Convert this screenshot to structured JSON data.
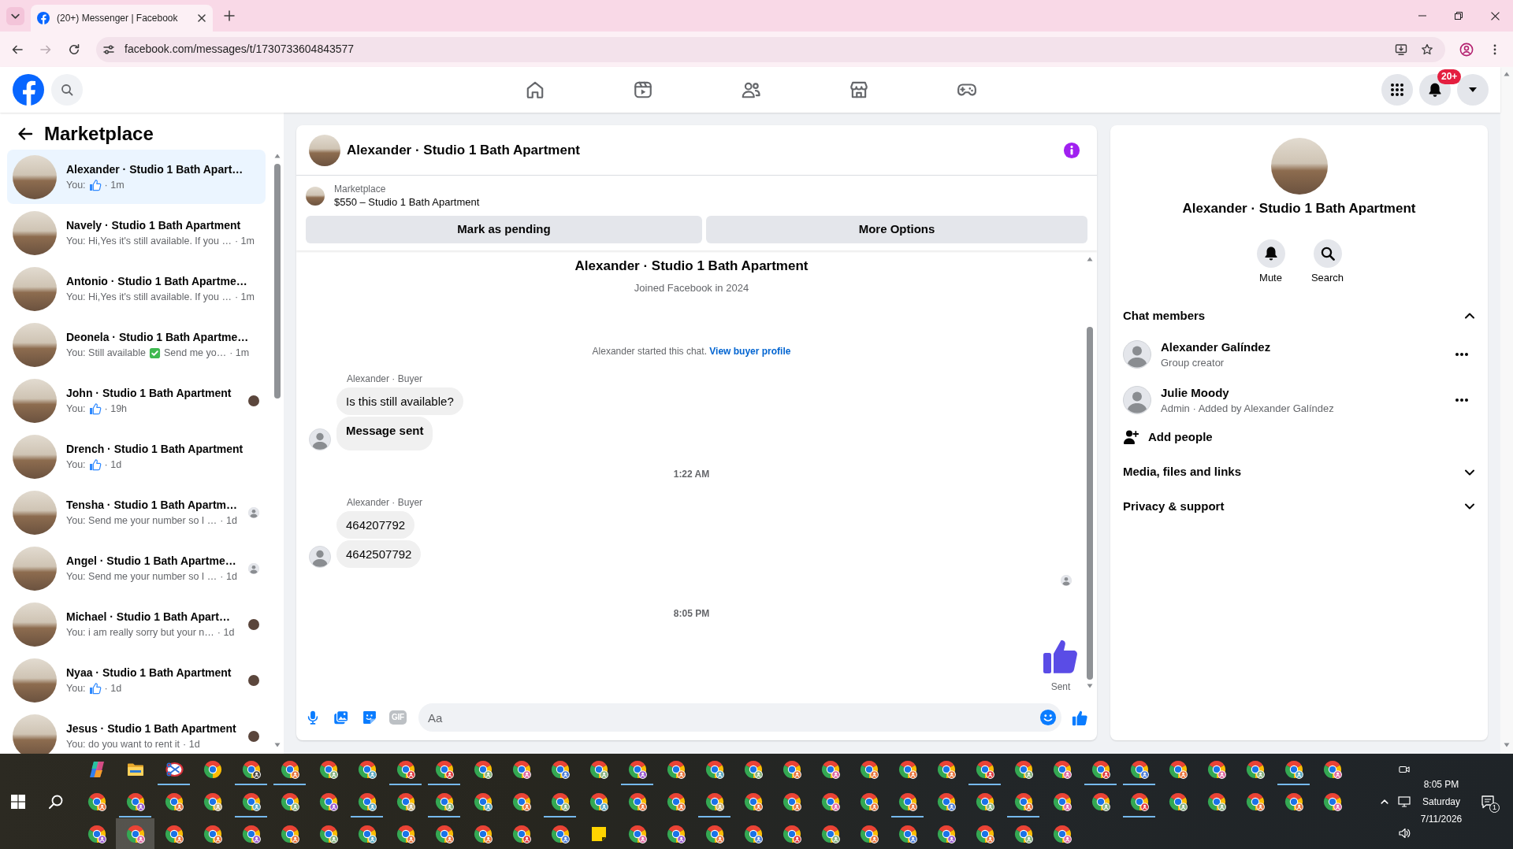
{
  "browser": {
    "tabs": [
      {
        "title": "(20+) Messenger | Facebook",
        "selected": true
      }
    ],
    "url": "facebook.com/messages/t/1730733604843577"
  },
  "header": {
    "nav": [
      {
        "kind": "home",
        "selected": false
      },
      {
        "kind": "video",
        "selected": false
      },
      {
        "kind": "friends",
        "selected": false
      },
      {
        "kind": "marketplace",
        "selected": false
      },
      {
        "kind": "gaming",
        "selected": false
      }
    ],
    "notification_badge": "20+"
  },
  "sidebar": {
    "title": "Marketplace",
    "conversations": [
      {
        "name": "Alexander · Studio 1 Bath Apart…",
        "preview": [
          {
            "kind": "text",
            "text": "You:"
          },
          {
            "kind": "like"
          }
        ],
        "time": "· 1m",
        "selected": true
      },
      {
        "name": "Navely · Studio 1 Bath Apartment",
        "preview": [
          {
            "kind": "text",
            "text": "You: Hi,Yes it's still available. If you …"
          }
        ],
        "time": "· 1m",
        "selected": false
      },
      {
        "name": "Antonio · Studio 1 Bath Apartme…",
        "preview": [
          {
            "kind": "text",
            "text": "You: Hi,Yes it's still available. If you …"
          }
        ],
        "time": "· 1m",
        "selected": false
      },
      {
        "name": "Deonela · Studio 1 Bath Apartme…",
        "preview": [
          {
            "kind": "text",
            "text": "You: Still available"
          },
          {
            "kind": "check"
          },
          {
            "kind": "text",
            "text": "Send me yo…"
          }
        ],
        "time": "· 1m",
        "selected": false
      },
      {
        "name": "John · Studio 1 Bath Apartment",
        "preview": [
          {
            "kind": "text",
            "text": "You:"
          },
          {
            "kind": "like"
          }
        ],
        "time": "· 19h",
        "selected": false,
        "seen": {
          "kind": "photo"
        }
      },
      {
        "name": "Drench · Studio 1 Bath Apartment",
        "preview": [
          {
            "kind": "text",
            "text": "You:"
          },
          {
            "kind": "like"
          }
        ],
        "time": "· 1d",
        "selected": false
      },
      {
        "name": "Tensha · Studio 1 Bath Apartm…",
        "preview": [
          {
            "kind": "text",
            "text": "You: Send me your number so I …"
          }
        ],
        "time": "· 1d",
        "selected": false,
        "seen": {
          "kind": "placeholder"
        }
      },
      {
        "name": "Angel · Studio 1 Bath Apartme…",
        "preview": [
          {
            "kind": "text",
            "text": "You: Send me your number so I …"
          }
        ],
        "time": "· 1d",
        "selected": false,
        "seen": {
          "kind": "placeholder"
        }
      },
      {
        "name": "Michael · Studio 1 Bath Apart…",
        "preview": [
          {
            "kind": "text",
            "text": "You: i am really sorry but your n…"
          }
        ],
        "time": "· 1d",
        "selected": false,
        "seen": {
          "kind": "photo"
        }
      },
      {
        "name": "Nyaa · Studio 1 Bath Apartment",
        "preview": [
          {
            "kind": "text",
            "text": "You:"
          },
          {
            "kind": "like"
          }
        ],
        "time": "· 1d",
        "selected": false,
        "seen": {
          "kind": "photo"
        }
      },
      {
        "name": "Jesus · Studio 1 Bath Apartment",
        "preview": [
          {
            "kind": "text",
            "text": "You: do you want to rent it"
          }
        ],
        "time": "· 1d",
        "selected": false,
        "seen": {
          "kind": "photo"
        }
      }
    ]
  },
  "chat": {
    "header": {
      "title": "Alexander · Studio 1 Bath Apartment"
    },
    "listing": {
      "label": "Marketplace",
      "title": "$550 – Studio 1 Bath Apartment"
    },
    "actions": [
      {
        "label": "Mark as pending"
      },
      {
        "label": "More Options"
      }
    ],
    "thread": [
      {
        "kind": "intro",
        "title": "Alexander · Studio 1 Bath Apartment",
        "subtitle": "Joined Facebook in 2024"
      },
      {
        "kind": "notice",
        "text": "Alexander started this chat.",
        "link": "View buyer profile"
      },
      {
        "kind": "group",
        "sender": "Alexander · Buyer",
        "bubbles": [
          {
            "text": "Is this still available?",
            "bold": false
          },
          {
            "text": "Message sent",
            "bold": true
          }
        ]
      },
      {
        "kind": "time",
        "text": "1:22 AM"
      },
      {
        "kind": "group",
        "sender": "Alexander · Buyer",
        "bubbles": [
          {
            "text": "464207792",
            "bold": false
          },
          {
            "text": "4642507792",
            "bold": false
          }
        ]
      },
      {
        "kind": "seen"
      },
      {
        "kind": "time",
        "text": "8:05 PM"
      },
      {
        "kind": "like",
        "status": "Sent"
      }
    ],
    "composer": {
      "tools": [
        {
          "kind": "mic"
        },
        {
          "kind": "photo"
        },
        {
          "kind": "sticker"
        },
        {
          "kind": "gif",
          "label": "GIF"
        }
      ],
      "placeholder": "Aa"
    }
  },
  "details": {
    "title": "Alexander · Studio 1 Bath Apartment",
    "actions": [
      {
        "kind": "mute",
        "label": "Mute"
      },
      {
        "kind": "search",
        "label": "Search"
      }
    ],
    "sections": [
      {
        "title": "Chat members",
        "expanded": true,
        "members": [
          {
            "name": "Alexander Galíndez",
            "role": "Group creator"
          },
          {
            "name": "Julie Moody",
            "role": "Admin · Added by Alexander Galíndez"
          }
        ],
        "add_label": "Add people"
      },
      {
        "title": "Media, files and links",
        "expanded": false
      },
      {
        "title": "Privacy & support",
        "expanded": false
      }
    ]
  },
  "taskbar": {
    "rows": [
      [
        {
          "kind": "copilot",
          "running": false,
          "selected": false
        },
        {
          "kind": "explorer",
          "running": false,
          "selected": false
        },
        {
          "kind": "snipping-tool",
          "running": true,
          "selected": false
        },
        {
          "kind": "chrome",
          "running": false,
          "selected": false
        },
        {
          "kind": "chrome",
          "color": "#4a4440",
          "running": true,
          "selected": false
        },
        {
          "kind": "chrome",
          "color": "#e8743b",
          "running": true,
          "selected": false
        },
        {
          "kind": "chrome",
          "color": "#86b37f",
          "running": false,
          "selected": false
        },
        {
          "kind": "chrome",
          "color": "#5aa9c2",
          "running": false,
          "selected": false
        },
        {
          "kind": "chrome",
          "color": "#e0383e",
          "running": true,
          "selected": false
        },
        {
          "kind": "chrome",
          "color": "#e0383e",
          "running": true,
          "selected": false
        },
        {
          "kind": "chrome",
          "color": "#86b37f",
          "running": false,
          "selected": false
        },
        {
          "kind": "chrome",
          "color": "#e06aa3",
          "running": false,
          "selected": false
        },
        {
          "kind": "chrome",
          "color": "#4f7fd8",
          "running": false,
          "selected": false
        },
        {
          "kind": "chrome",
          "color": "#86b37f",
          "running": false,
          "selected": false
        },
        {
          "kind": "chrome",
          "color": "#9a5bd1",
          "running": true,
          "selected": false
        },
        {
          "kind": "chrome",
          "color": "#e8743b",
          "running": false,
          "selected": false
        },
        {
          "kind": "chrome",
          "color": "#5aa9c2",
          "running": false,
          "selected": false
        },
        {
          "kind": "chrome",
          "color": "#86b37f",
          "running": false,
          "selected": false
        },
        {
          "kind": "chrome",
          "color": "#e8743b",
          "running": false,
          "selected": false
        },
        {
          "kind": "chrome",
          "color": "#e06aa3",
          "running": false,
          "selected": false
        },
        {
          "kind": "chrome",
          "color": "#e8743b",
          "running": false,
          "selected": false
        },
        {
          "kind": "chrome",
          "color": "#e8743b",
          "running": false,
          "selected": false
        },
        {
          "kind": "chrome",
          "color": "#e8743b",
          "running": false,
          "selected": false
        },
        {
          "kind": "chrome",
          "color": "#e0383e",
          "running": true,
          "selected": false
        },
        {
          "kind": "chrome",
          "color": "#86b37f",
          "running": false,
          "selected": false
        },
        {
          "kind": "chrome",
          "color": "#e06aa3",
          "running": false,
          "selected": false
        },
        {
          "kind": "chrome",
          "color": "#e0383e",
          "running": true,
          "selected": false
        },
        {
          "kind": "chrome",
          "color": "#4f7fd8",
          "running": true,
          "selected": false
        },
        {
          "kind": "chrome",
          "color": "#e8743b",
          "running": false,
          "selected": false
        },
        {
          "kind": "chrome",
          "color": "#e06aa3",
          "running": false,
          "selected": false
        },
        {
          "kind": "chrome",
          "color": "#86b37f",
          "running": false,
          "selected": false
        },
        {
          "kind": "chrome",
          "color": "#5aa9c2",
          "running": true,
          "selected": false
        },
        {
          "kind": "chrome",
          "color": "#e06aa3",
          "running": false,
          "selected": false
        }
      ],
      [
        {
          "kind": "chrome",
          "color": "#e8743b",
          "running": false,
          "selected": false
        },
        {
          "kind": "chrome",
          "color": "#9a5bd1",
          "running": true,
          "selected": false
        },
        {
          "kind": "chrome",
          "color": "#e8743b",
          "running": false,
          "selected": false
        },
        {
          "kind": "chrome",
          "color": "#c8b27e",
          "running": false,
          "selected": false
        },
        {
          "kind": "chrome",
          "color": "#5aa9c2",
          "running": true,
          "selected": false
        },
        {
          "kind": "chrome",
          "color": "#86b37f",
          "running": false,
          "selected": false
        },
        {
          "kind": "chrome",
          "color": "#9a5bd1",
          "running": false,
          "selected": false
        },
        {
          "kind": "chrome",
          "color": "#5aa9c2",
          "running": true,
          "selected": false
        },
        {
          "kind": "chrome",
          "color": "#c8b27e",
          "running": false,
          "selected": false
        },
        {
          "kind": "chrome",
          "color": "#86b37f",
          "running": true,
          "selected": false
        },
        {
          "kind": "chrome",
          "color": "#5aa9c2",
          "running": false,
          "selected": false
        },
        {
          "kind": "chrome",
          "color": "#e8743b",
          "running": false,
          "selected": false
        },
        {
          "kind": "chrome",
          "color": "#86b37f",
          "running": true,
          "selected": false
        },
        {
          "kind": "chrome",
          "color": "#5aa9c2",
          "running": false,
          "selected": false
        },
        {
          "kind": "chrome",
          "color": "#e8743b",
          "running": false,
          "selected": false
        },
        {
          "kind": "chrome",
          "color": "#e8743b",
          "running": false,
          "selected": false
        },
        {
          "kind": "chrome",
          "color": "#c8b27e",
          "running": true,
          "selected": false
        },
        {
          "kind": "chrome",
          "color": "#e8743b",
          "running": false,
          "selected": false
        },
        {
          "kind": "chrome",
          "color": "#e8743b",
          "running": false,
          "selected": false
        },
        {
          "kind": "chrome",
          "color": "#e06aa3",
          "running": false,
          "selected": false
        },
        {
          "kind": "chrome",
          "color": "#e8743b",
          "running": false,
          "selected": false
        },
        {
          "kind": "chrome",
          "color": "#e8743b",
          "running": true,
          "selected": false
        },
        {
          "kind": "chrome",
          "color": "#4f7fd8",
          "running": false,
          "selected": false
        },
        {
          "kind": "chrome",
          "color": "#86b37f",
          "running": false,
          "selected": false
        },
        {
          "kind": "chrome",
          "color": "#e8743b",
          "running": true,
          "selected": false
        },
        {
          "kind": "chrome",
          "color": "#e06aa3",
          "running": false,
          "selected": false
        },
        {
          "kind": "chrome",
          "color": "#86b37f",
          "running": false,
          "selected": false
        },
        {
          "kind": "chrome",
          "color": "#e0383e",
          "running": true,
          "selected": false
        },
        {
          "kind": "chrome",
          "color": "#86b37f",
          "running": false,
          "selected": false
        },
        {
          "kind": "chrome",
          "color": "#86b37f",
          "running": false,
          "selected": false
        },
        {
          "kind": "chrome",
          "color": "#e8743b",
          "running": false,
          "selected": false
        },
        {
          "kind": "chrome",
          "color": "#e8743b",
          "running": false,
          "selected": false
        },
        {
          "kind": "chrome",
          "color": "#e06aa3",
          "running": false,
          "selected": false
        }
      ],
      [
        {
          "kind": "chrome",
          "color": "#9a5bd1",
          "running": false,
          "selected": false
        },
        {
          "kind": "chrome",
          "color": "#e06aa3",
          "running": false,
          "selected": true
        },
        {
          "kind": "chrome",
          "color": "#e8743b",
          "running": false,
          "selected": false
        },
        {
          "kind": "chrome",
          "color": "#e8743b",
          "running": false,
          "selected": false
        },
        {
          "kind": "chrome",
          "color": "#9a5bd1",
          "running": false,
          "selected": false
        },
        {
          "kind": "chrome",
          "color": "#e8743b",
          "running": false,
          "selected": false
        },
        {
          "kind": "chrome",
          "color": "#86b37f",
          "running": false,
          "selected": false
        },
        {
          "kind": "chrome",
          "color": "#5aa9c2",
          "running": false,
          "selected": false
        },
        {
          "kind": "chrome",
          "color": "#e8743b",
          "running": false,
          "selected": false
        },
        {
          "kind": "chrome",
          "color": "#e8743b",
          "running": false,
          "selected": false
        },
        {
          "kind": "chrome",
          "color": "#e8743b",
          "running": false,
          "selected": false
        },
        {
          "kind": "chrome",
          "color": "#e0383e",
          "running": false,
          "selected": false
        },
        {
          "kind": "chrome",
          "color": "#4f7fd8",
          "running": false,
          "selected": false
        },
        {
          "kind": "sticky-notes",
          "running": false,
          "selected": false
        },
        {
          "kind": "chrome",
          "color": "#e06aa3",
          "running": false,
          "selected": false
        },
        {
          "kind": "chrome",
          "color": "#9a5bd1",
          "running": false,
          "selected": false
        },
        {
          "kind": "chrome",
          "color": "#e8743b",
          "running": false,
          "selected": false
        },
        {
          "kind": "chrome",
          "color": "#4f7fd8",
          "running": false,
          "selected": false
        },
        {
          "kind": "chrome",
          "color": "#e0383e",
          "running": false,
          "selected": false
        },
        {
          "kind": "chrome",
          "color": "#86b37f",
          "running": false,
          "selected": false
        },
        {
          "kind": "chrome",
          "color": "#e8743b",
          "running": false,
          "selected": false
        },
        {
          "kind": "chrome",
          "color": "#4f7fd8",
          "running": false,
          "selected": false
        },
        {
          "kind": "chrome",
          "color": "#9a5bd1",
          "running": false,
          "selected": false
        },
        {
          "kind": "chrome",
          "color": "#e8743b",
          "running": false,
          "selected": false
        },
        {
          "kind": "chrome",
          "color": "#86b37f",
          "running": false,
          "selected": false
        },
        {
          "kind": "chrome",
          "color": "#e06aa3",
          "running": false,
          "selected": false
        }
      ]
    ],
    "clock": {
      "time": "8:05 PM",
      "day": "Saturday",
      "date": "7/11/2026"
    },
    "notification_count": "1"
  }
}
